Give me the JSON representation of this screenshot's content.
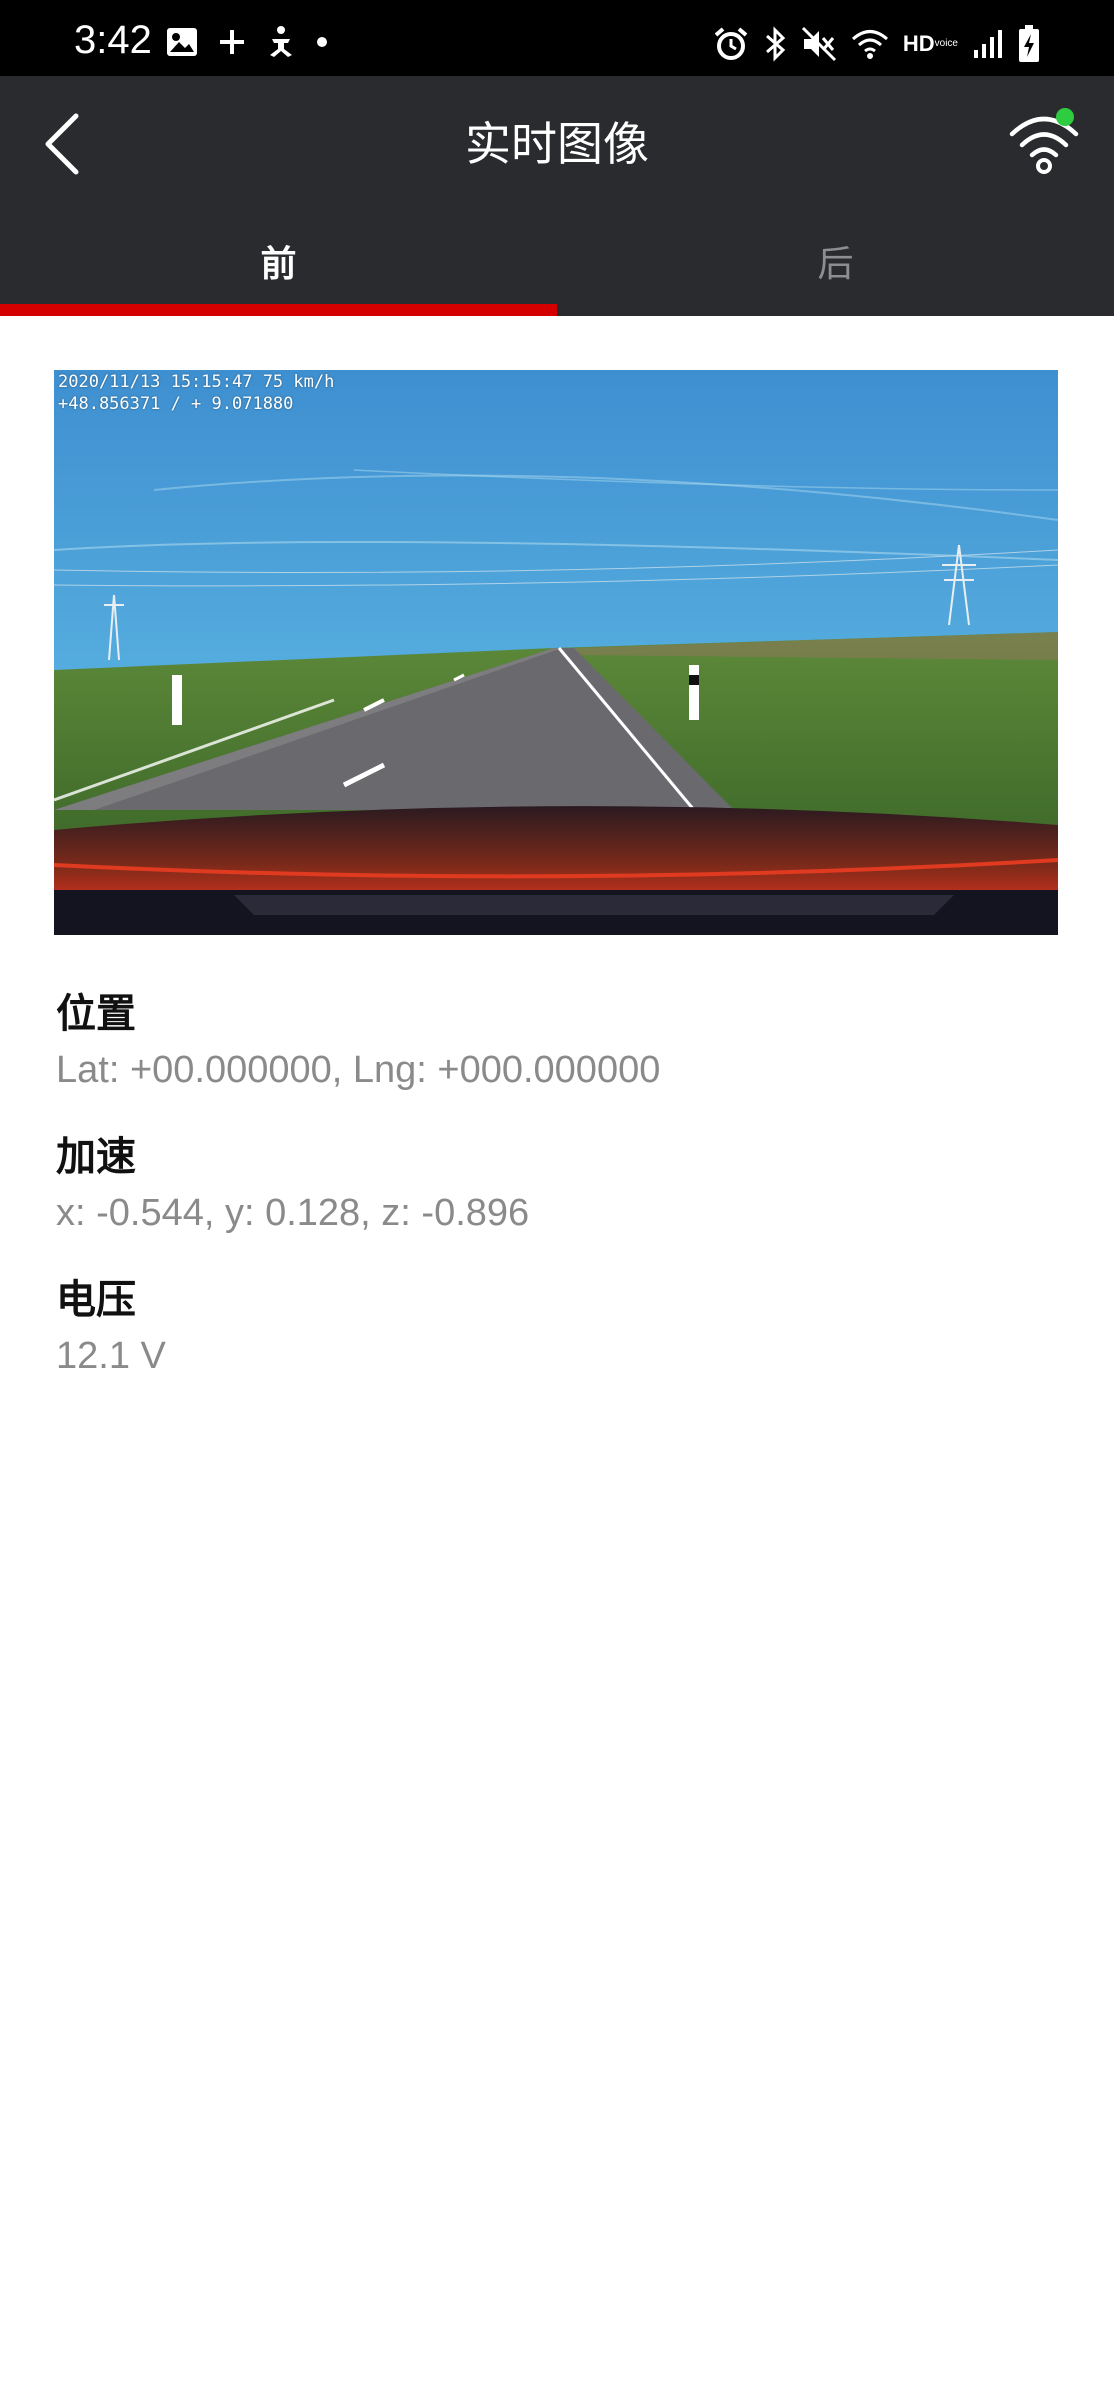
{
  "status_bar": {
    "time": "3:42",
    "left_icons": [
      "image-icon",
      "plus-icon",
      "accessibility-icon",
      "dot-icon"
    ],
    "right_icons": [
      "alarm-icon",
      "bluetooth-icon",
      "mute-icon",
      "wifi-icon",
      "hd-voice-icon",
      "signal-icon",
      "battery-charging-icon"
    ],
    "hd_label": "HD",
    "voice_label": "voice"
  },
  "header": {
    "title": "实时图像",
    "wifi_status_color": "#2ecc40"
  },
  "tabs": [
    {
      "label": "前",
      "active": true
    },
    {
      "label": "后",
      "active": false
    }
  ],
  "colors": {
    "header_bg": "#2a2b2f",
    "accent": "#d40000",
    "inactive_tab": "#8d8e92"
  },
  "camera": {
    "overlay_line1": "2020/11/13  15:15:47   75 km/h",
    "overlay_line2": "+48.856371 / +  9.071880"
  },
  "info": {
    "position": {
      "label": "位置",
      "value": "Lat: +00.000000, Lng: +000.000000"
    },
    "acceleration": {
      "label": "加速",
      "value": "x: -0.544, y: 0.128, z: -0.896"
    },
    "voltage": {
      "label": "电压",
      "value": "12.1 V"
    }
  }
}
